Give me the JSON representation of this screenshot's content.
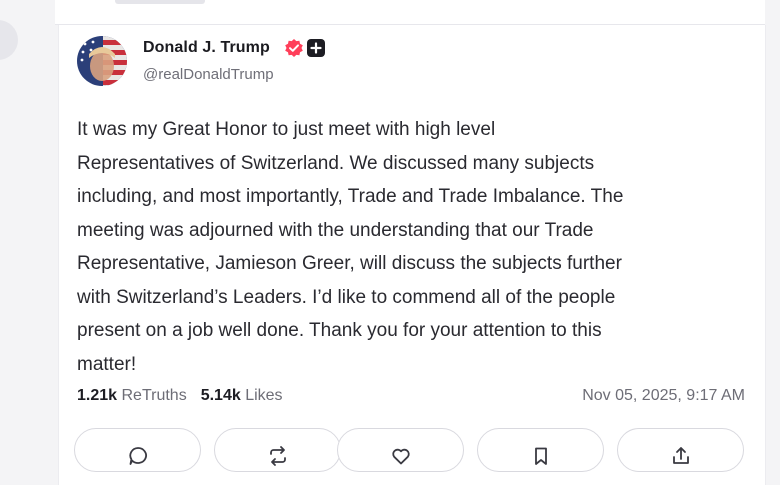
{
  "post": {
    "author_name": "Donald J. Trump",
    "author_handle": "@realDonaldTrump",
    "text": "It was my Great Honor to just meet with high level\nRepresentatives of Switzerland. We discussed many subjects\nincluding, and most importantly, Trade and Trade Imbalance. The\nmeeting was adjourned with the understanding that our Trade\nRepresentative, Jamieson Greer, will discuss the subjects further\nwith Switzerland’s Leaders. I’d like to commend all of the people\npresent on a job well done. Thank you for your attention to this\nmatter!",
    "retruths_count": "1.21k",
    "retruths_label": "ReTruths",
    "likes_count": "5.14k",
    "likes_label": "Likes",
    "timestamp": "Nov 05, 2025, 9:17 AM"
  },
  "icons": {
    "verified": "verified-badge-icon",
    "plus": "plus-badge-icon",
    "reply": "comment-icon",
    "retruth": "repost-icon",
    "like": "heart-icon",
    "bookmark": "bookmark-icon",
    "share": "share-icon"
  },
  "colors": {
    "verified_badge": "#ff3f5a",
    "text": "#2a2a30",
    "muted": "#6d6d76"
  }
}
